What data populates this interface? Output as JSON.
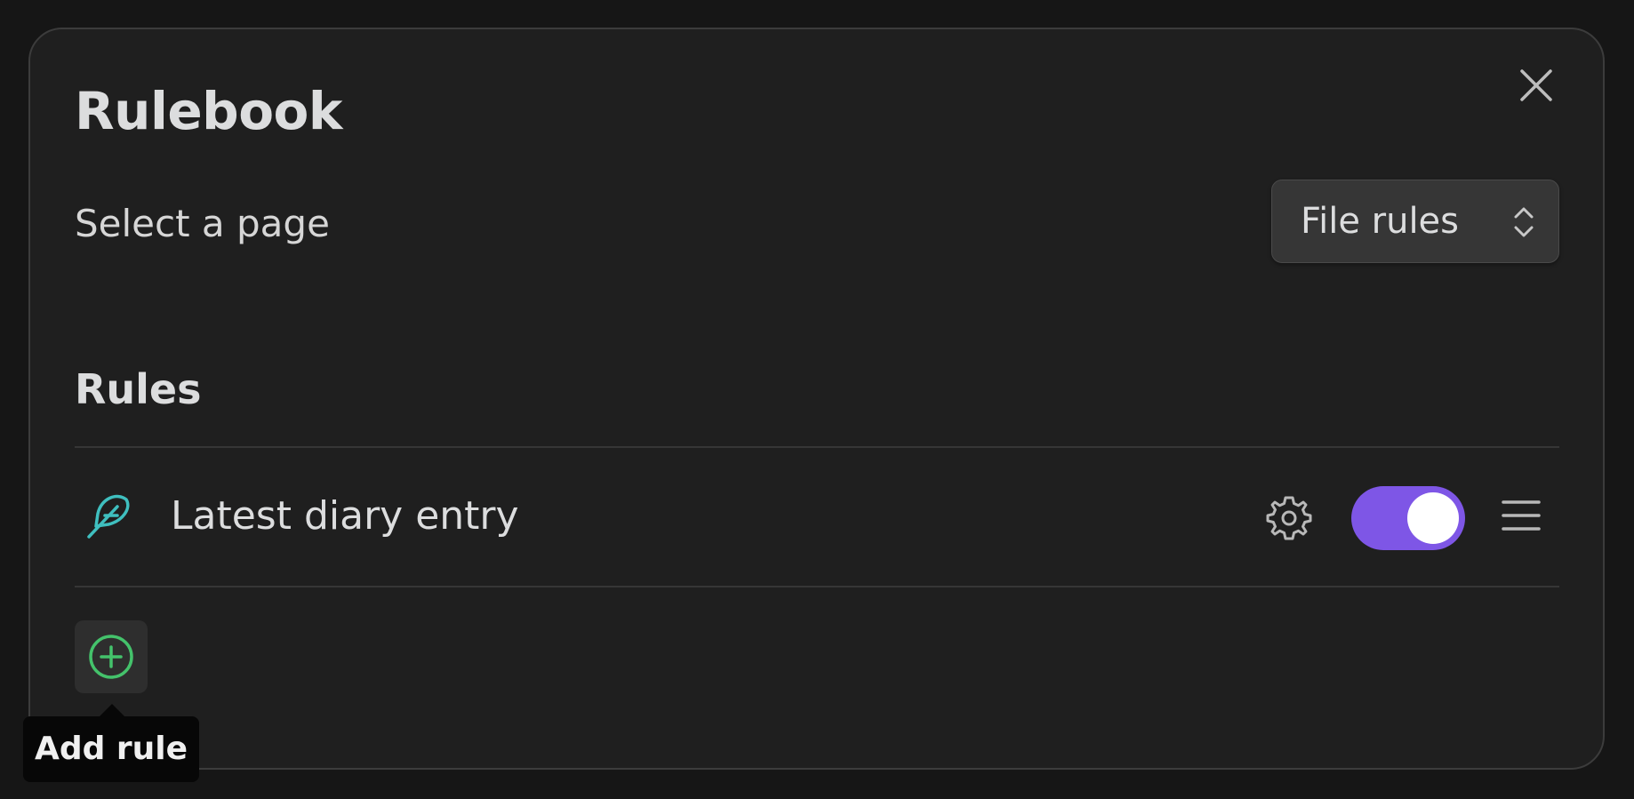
{
  "modal": {
    "title": "Rulebook",
    "close_icon": "close-icon"
  },
  "page_select": {
    "label": "Select a page",
    "selected": "File rules",
    "icon": "chevron-up-down-icon"
  },
  "rules_section": {
    "heading": "Rules",
    "items": [
      {
        "icon": "feather-icon",
        "icon_color": "#3fbfbf",
        "name": "Latest diary entry",
        "settings_icon": "gear-icon",
        "enabled": true,
        "drag_icon": "menu-icon"
      }
    ]
  },
  "add_rule": {
    "icon": "plus-circle-icon",
    "icon_color": "#44c26b",
    "tooltip": "Add rule"
  },
  "colors": {
    "accent": "#7e56e6",
    "background": "#1f1f1f"
  }
}
